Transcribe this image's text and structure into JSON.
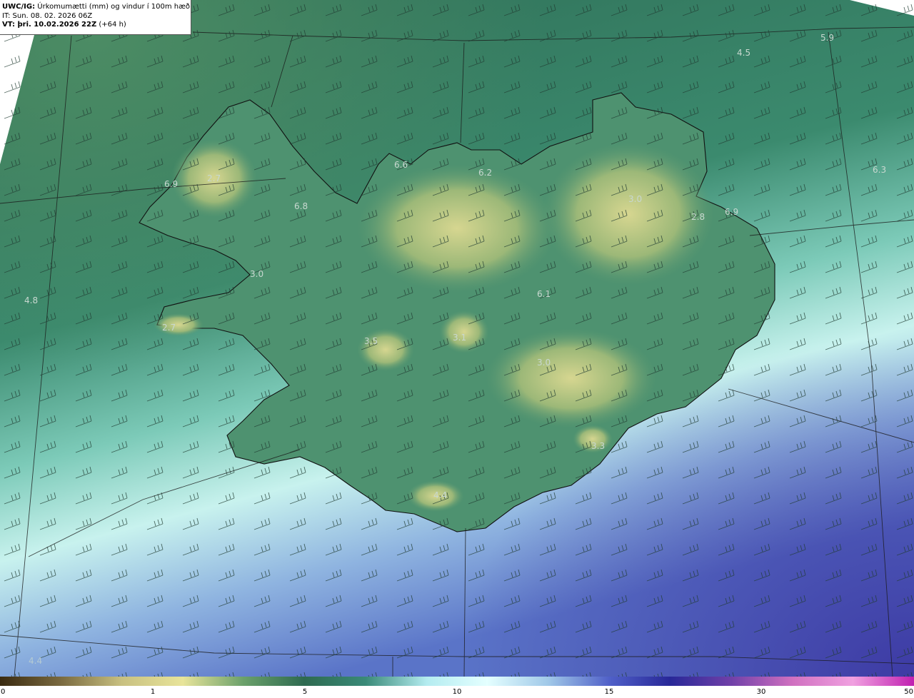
{
  "header": {
    "model": "UWC/IG:",
    "title": "Úrkomumætti (mm) og vindur í 100m hæð",
    "init_time": "IT: Sun. 08. 02. 2026 06Z",
    "valid_prefix": "VT: þri. 10.02.2026 22Z",
    "valid_suffix": "(+64 h)"
  },
  "values": [
    {
      "id": "v1",
      "text": "4.5"
    },
    {
      "id": "v2",
      "text": "5.9"
    },
    {
      "id": "v3",
      "text": "6.3"
    },
    {
      "id": "v4",
      "text": "6.9"
    },
    {
      "id": "v5",
      "text": "2.7"
    },
    {
      "id": "v6",
      "text": "6.8"
    },
    {
      "id": "v7",
      "text": "6.6"
    },
    {
      "id": "v8",
      "text": "6.2"
    },
    {
      "id": "v9",
      "text": "3.0"
    },
    {
      "id": "v10",
      "text": "2.8"
    },
    {
      "id": "v11",
      "text": "6.9"
    },
    {
      "id": "v12",
      "text": "3.0"
    },
    {
      "id": "v13",
      "text": "4.8"
    },
    {
      "id": "v14",
      "text": "6.1"
    },
    {
      "id": "v15",
      "text": "2.7"
    },
    {
      "id": "v16",
      "text": "3.5"
    },
    {
      "id": "v17",
      "text": "3.1"
    },
    {
      "id": "v18",
      "text": "3.0"
    },
    {
      "id": "v19",
      "text": "3.3"
    },
    {
      "id": "v20",
      "text": "4.4"
    },
    {
      "id": "v21",
      "text": "4.4"
    }
  ],
  "colorbar": {
    "ticks": [
      "0",
      "1",
      "5",
      "10",
      "15",
      "30",
      "50"
    ],
    "colors": [
      "#3a2a10",
      "#7a6a40",
      "#c8c080",
      "#e8e49a",
      "#6aa06a",
      "#2e6a50",
      "#3a8a78",
      "#b4ecf0",
      "#e4ffff",
      "#a0c8e8",
      "#5060c8",
      "#282898",
      "#7040a8",
      "#d070c0",
      "#f0a0e0",
      "#c020b0"
    ]
  }
}
